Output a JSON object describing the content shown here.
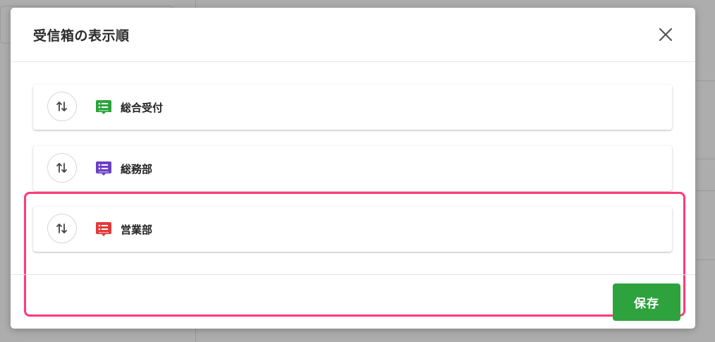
{
  "modal": {
    "title": "受信箱の表示順",
    "close_icon": "close-icon",
    "save_label": "保存",
    "save_color": "#2ea33d"
  },
  "inboxes": [
    {
      "label": "総合受付",
      "icon": "inbox-list-icon",
      "color": "#2ea33d"
    },
    {
      "label": "総務部",
      "icon": "inbox-list-icon",
      "color": "#6b3fc4"
    },
    {
      "label": "営業部",
      "icon": "inbox-list-icon",
      "color": "#e03a3a"
    }
  ],
  "highlight_color": "#ff3b77"
}
